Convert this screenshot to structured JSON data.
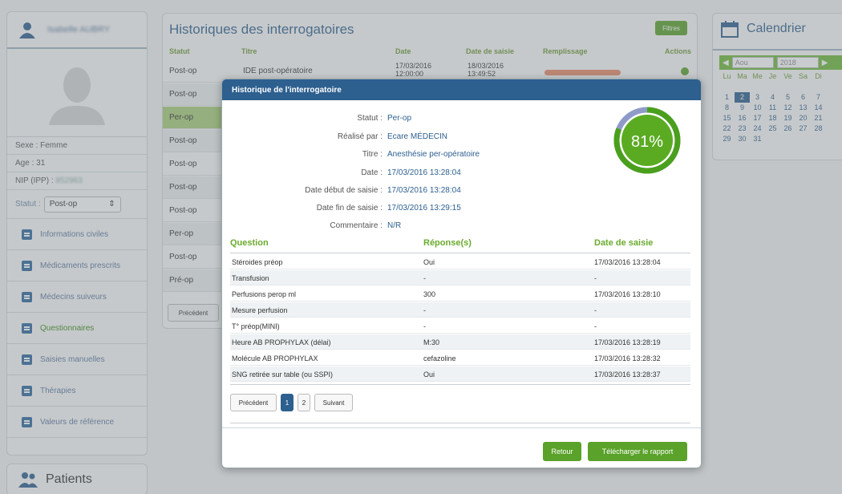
{
  "user": {
    "name": "Isabelle AUBRY",
    "sexe_label": "Sexe :",
    "sexe": "Femme",
    "age_label": "Age :",
    "age": "31",
    "nip_label": "NIP (IPP) :",
    "nip": "852963",
    "statut_label": "Statut :",
    "statut": "Post-op"
  },
  "menu": [
    {
      "label": "Informations civiles"
    },
    {
      "label": "Médicaments prescrits"
    },
    {
      "label": "Médecins suiveurs"
    },
    {
      "label": "Questionnaires"
    },
    {
      "label": "Saisies manuelles"
    },
    {
      "label": "Thérapies"
    },
    {
      "label": "Valeurs de référence"
    }
  ],
  "patients_label": "Patients",
  "historique": {
    "title": "Historiques des interrogatoires",
    "filtres": "Filtres",
    "headers": {
      "statut": "Statut",
      "titre": "Titre",
      "date": "Date",
      "date_saisie": "Date de saisie",
      "remplissage": "Remplissage",
      "actions": "Actions"
    },
    "first": {
      "titre": "IDE post-opératoire",
      "date": "17/03/2016 12:00:00",
      "date_saisie": "18/03/2016 13:49:52",
      "remplissage": 0.45
    },
    "rows": [
      "Post-op",
      "Post-op",
      "Per-op",
      "Post-op",
      "Post-op",
      "Post-op",
      "Post-op",
      "Per-op",
      "Post-op",
      "Pré-op"
    ],
    "precedent": "Précédent"
  },
  "calendar": {
    "title": "Calendrier",
    "month": "Aou",
    "year": "2018",
    "days": [
      "Lu",
      "Ma",
      "Me",
      "Je",
      "Ve",
      "Sa",
      "Di"
    ],
    "weeks": [
      [
        "",
        "",
        "",
        "",
        "",
        "",
        ""
      ],
      [
        "1",
        "2",
        "3",
        "4",
        "5",
        "6",
        "7"
      ],
      [
        "8",
        "9",
        "10",
        "11",
        "12",
        "13",
        "14"
      ],
      [
        "15",
        "16",
        "17",
        "18",
        "19",
        "20",
        "21"
      ],
      [
        "22",
        "23",
        "24",
        "25",
        "26",
        "27",
        "28"
      ],
      [
        "29",
        "30",
        "31",
        "",
        "",
        "",
        ""
      ]
    ],
    "selected": "2"
  },
  "modal": {
    "title": "Historique de l'interrogatoire",
    "fields": [
      {
        "label": "Statut :",
        "value": "Per-op"
      },
      {
        "label": "Réalisé par :",
        "value": "Ecare MÉDECIN"
      },
      {
        "label": "Titre :",
        "value": "Anesthésie per-opératoire"
      },
      {
        "label": "Date :",
        "value": "17/03/2016 13:28:04"
      },
      {
        "label": "Date début de saisie :",
        "value": "17/03/2016 13:28:04"
      },
      {
        "label": "Date fin de saisie :",
        "value": "17/03/2016 13:29:15"
      },
      {
        "label": "Commentaire :",
        "value": "N/R"
      }
    ],
    "gauge_label": "81%",
    "gauge_fraction": 0.81,
    "table_headers": {
      "question": "Question",
      "reponse": "Réponse(s)",
      "date": "Date de saisie"
    },
    "table_rows": [
      {
        "question": "Stéroides préop",
        "reponse": "Oui",
        "date": "17/03/2016 13:28:04"
      },
      {
        "question": "Transfusion",
        "reponse": "-",
        "date": "-"
      },
      {
        "question": "Perfusions perop ml",
        "reponse": "300",
        "date": "17/03/2016 13:28:10"
      },
      {
        "question": "Mesure perfusion",
        "reponse": "-",
        "date": "-"
      },
      {
        "question": "T° préop(MINI)",
        "reponse": "-",
        "date": "-"
      },
      {
        "question": "Heure AB PROPHYLAX (délai)",
        "reponse": "M:30",
        "date": "17/03/2016 13:28:19"
      },
      {
        "question": "Molécule AB PROPHYLAX",
        "reponse": "cefazoline",
        "date": "17/03/2016 13:28:32"
      },
      {
        "question": "SNG retirée sur table (ou SSPI)",
        "reponse": "Oui",
        "date": "17/03/2016 13:28:37"
      }
    ],
    "pagination": {
      "prev": "Précédent",
      "page1": "1",
      "page2": "2",
      "next": "Suivant"
    },
    "retour": "Retour",
    "telecharger": "Télécharger le rapport"
  },
  "colors": {
    "brand_blue": "#2d5f8f",
    "green": "#5aa22a",
    "gauge_green": "#4aa01c",
    "gauge_track": "#8e9bc8"
  }
}
